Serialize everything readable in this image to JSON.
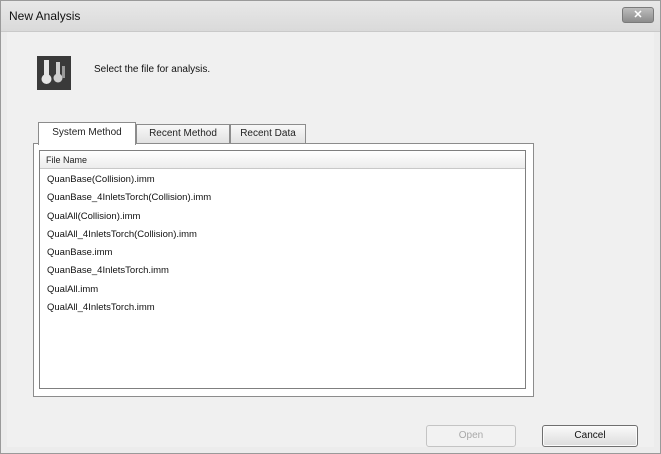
{
  "window": {
    "title": "New Analysis",
    "close_label": "✕"
  },
  "header": {
    "icon": "flask-icon",
    "instruction": "Select the file for analysis."
  },
  "tabs": [
    {
      "label": "System Method",
      "active": true
    },
    {
      "label": "Recent Method",
      "active": false
    },
    {
      "label": "Recent Data",
      "active": false
    }
  ],
  "file_list": {
    "column_header": "File Name",
    "rows": [
      "QuanBase(Collision).imm",
      "QuanBase_4InletsTorch(Collision).imm",
      "QualAll(Collision).imm",
      "QualAll_4InletsTorch(Collision).imm",
      "QuanBase.imm",
      "QuanBase_4InletsTorch.imm",
      "QualAll.imm",
      "QualAll_4InletsTorch.imm"
    ]
  },
  "buttons": {
    "open": "Open",
    "cancel": "Cancel"
  }
}
